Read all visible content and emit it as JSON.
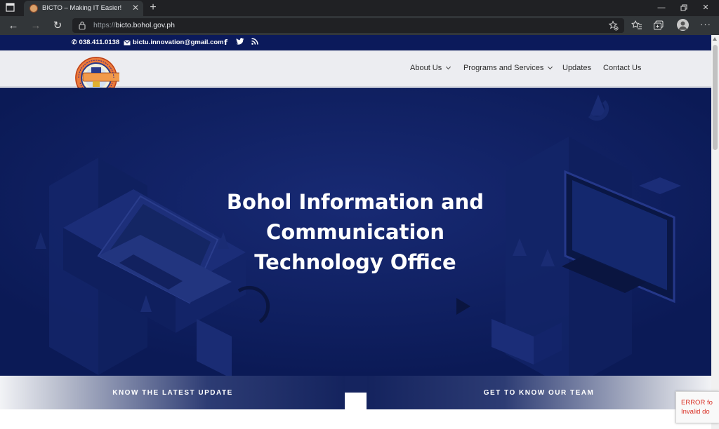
{
  "browser": {
    "tab": {
      "title": "BICTO – Making IT Easier!"
    },
    "address": {
      "protocol": "https://",
      "host": "bicto.bohol.gov.ph"
    }
  },
  "topbar": {
    "phone": "038.411.0138",
    "email": "bictu.innovation@gmail.com",
    "social_icons": [
      "facebook-icon",
      "twitter-icon",
      "rss-icon"
    ]
  },
  "nav": {
    "items": [
      {
        "label": "About Us",
        "has_dropdown": true
      },
      {
        "label": "Programs and Services",
        "has_dropdown": true
      },
      {
        "label": "Updates",
        "has_dropdown": false
      },
      {
        "label": "Contact Us",
        "has_dropdown": false
      }
    ]
  },
  "hero": {
    "title_lines": [
      "Bohol Information and",
      "Communication",
      "Technology Office"
    ]
  },
  "cta": {
    "left": "KNOW THE LATEST UPDATE",
    "right": "GET TO KNOW OUR TEAM"
  },
  "recaptcha": {
    "line1": "ERROR fo",
    "line2": "Invalid do"
  },
  "colors": {
    "topbar": "#0b1a5b",
    "hero": "#0e1e5e",
    "header": "#ecedf1",
    "error": "#d93025"
  }
}
